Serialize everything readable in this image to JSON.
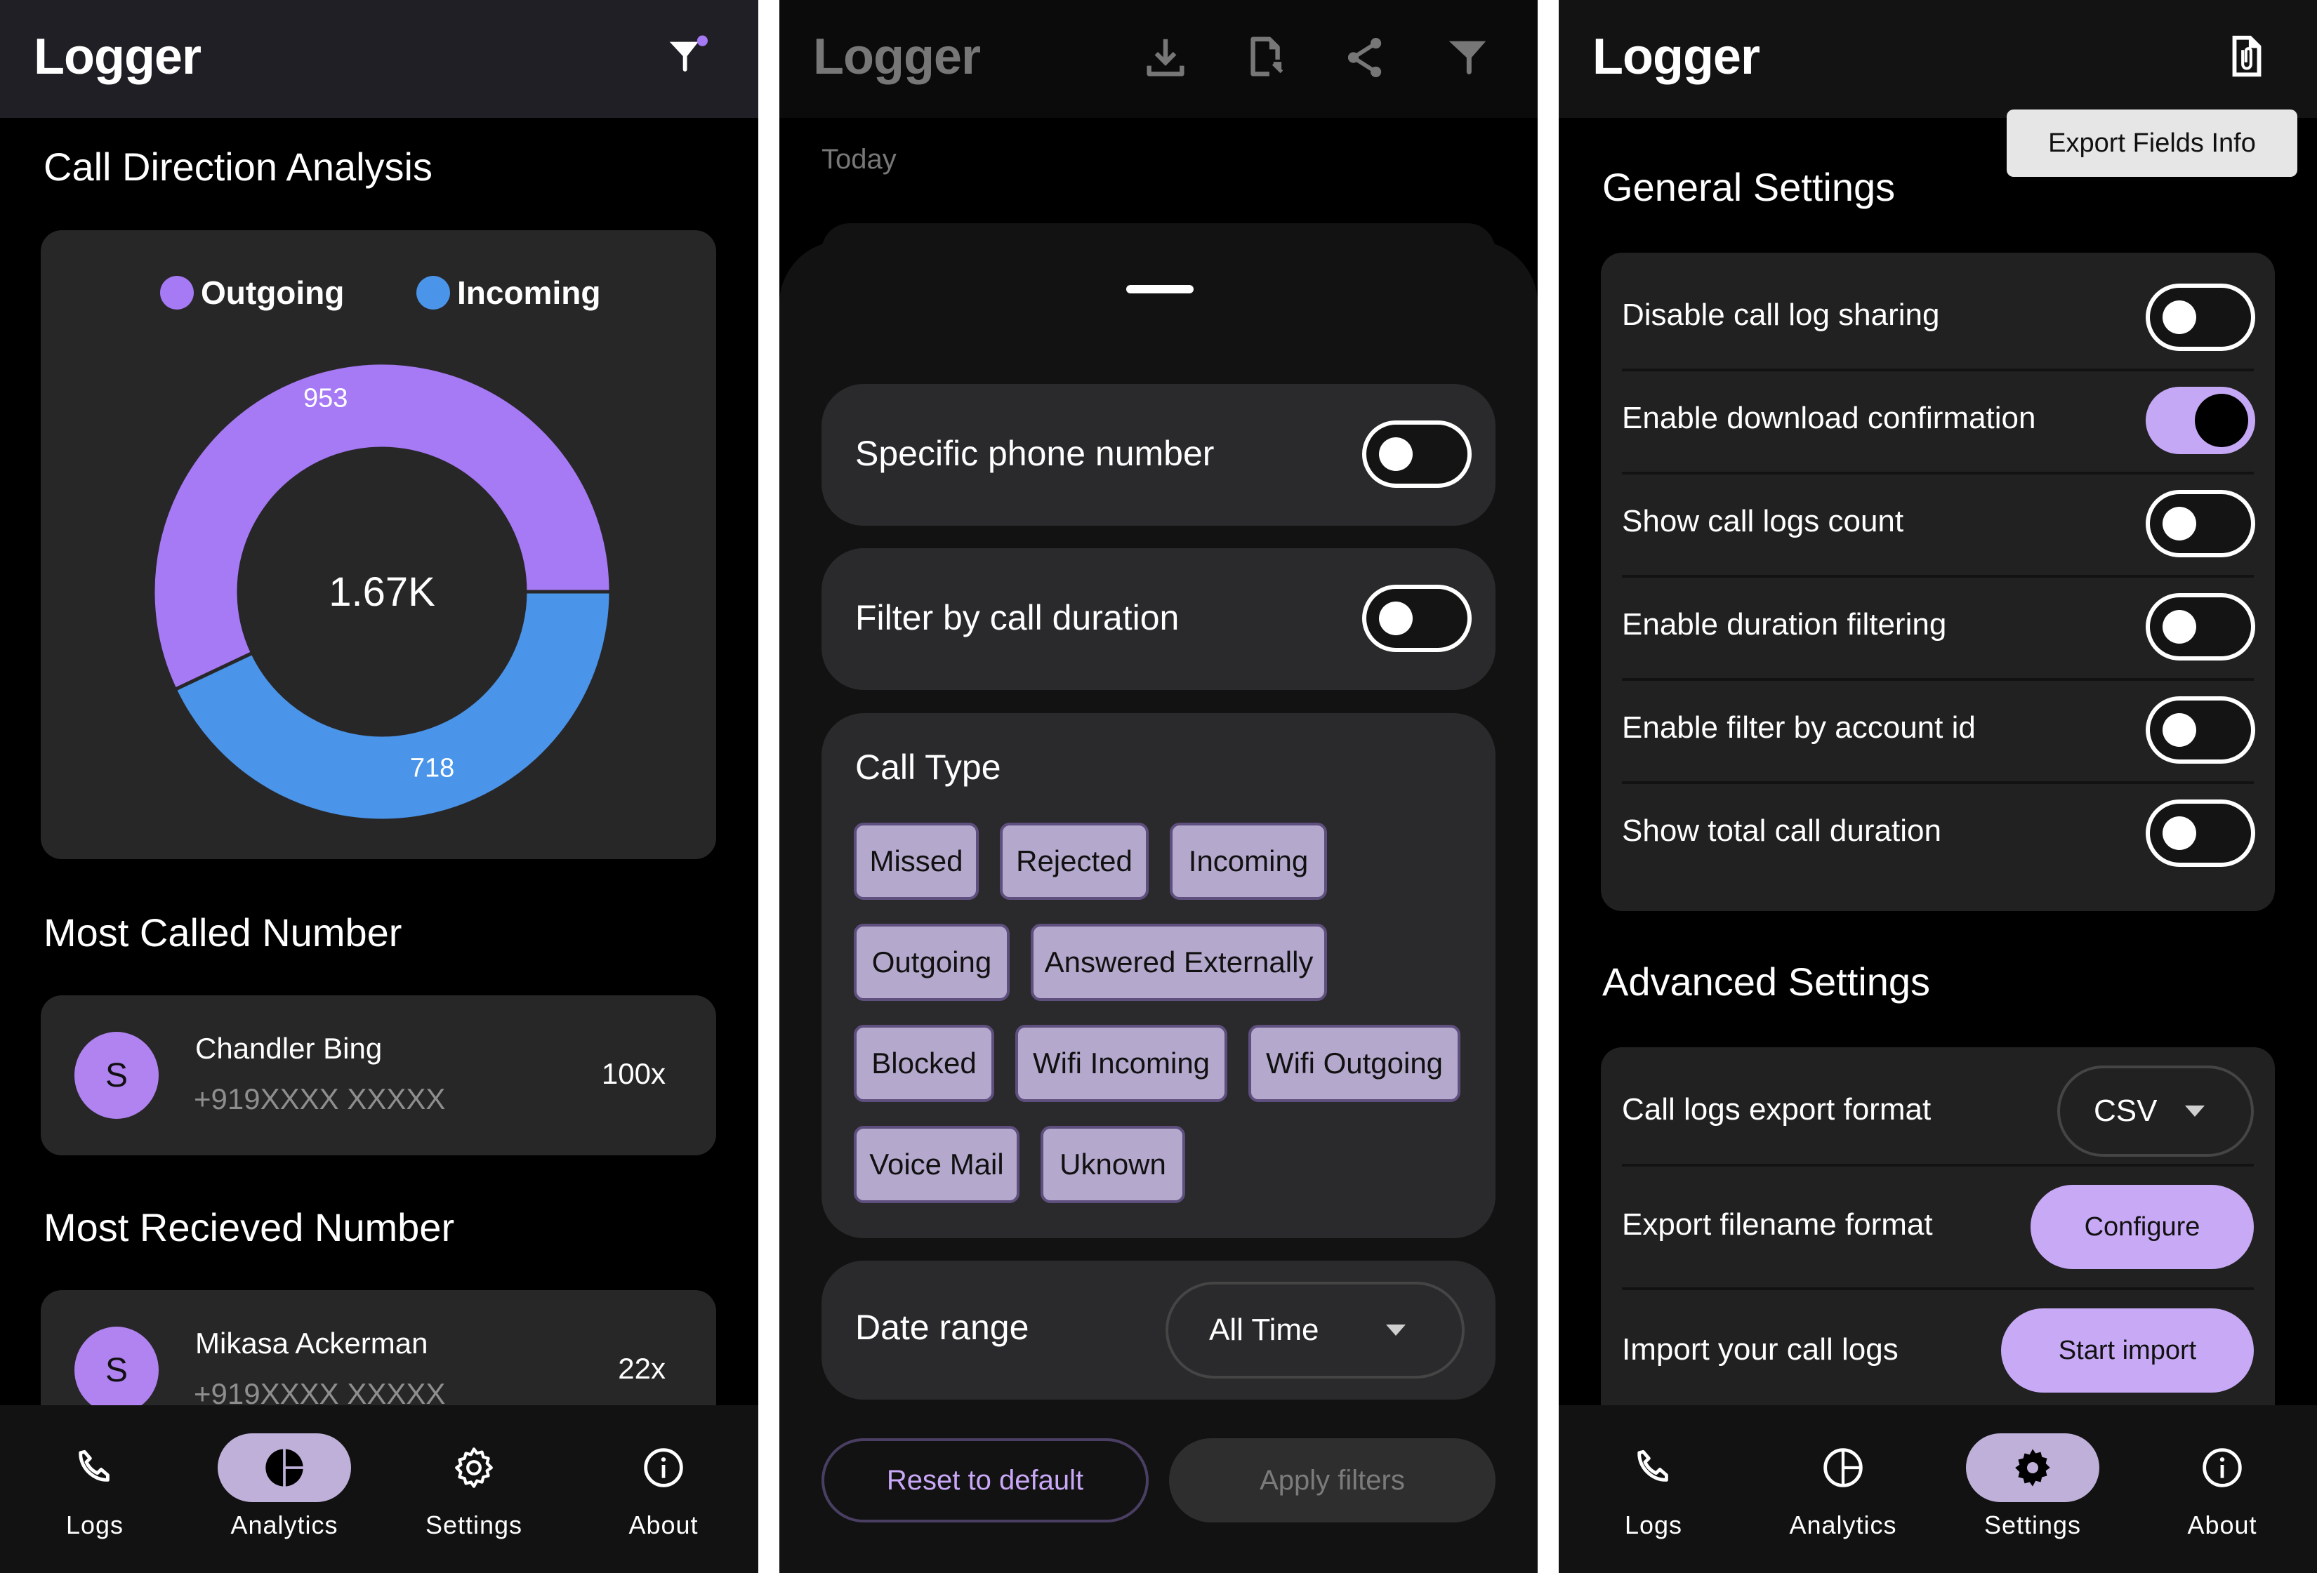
{
  "app": {
    "title": "Logger"
  },
  "colors": {
    "outgoing": "#A679F5",
    "incoming": "#4A94EA",
    "accent": "#C7A9F6",
    "nav_active": "#BFB0D9"
  },
  "nav": {
    "items": [
      {
        "label": "Logs",
        "icon": "phone-icon"
      },
      {
        "label": "Analytics",
        "icon": "pie-chart-icon"
      },
      {
        "label": "Settings",
        "icon": "gear-icon"
      },
      {
        "label": "About",
        "icon": "info-icon"
      }
    ]
  },
  "analytics": {
    "header_icon": "filter-icon",
    "section_title": "Call Direction Analysis",
    "total_label": "1.67K",
    "most_called_title": "Most Called Number",
    "most_called": {
      "avatar_letter": "S",
      "name": "Chandler Bing",
      "number": "+919XXXX XXXXX",
      "count": "100x"
    },
    "most_received_title": "Most Recieved Number",
    "most_received": {
      "avatar_letter": "S",
      "name": "Mikasa Ackerman",
      "number": "+919XXXX XXXXX",
      "count": "22x"
    },
    "active_nav": "Analytics"
  },
  "chart_data": {
    "type": "pie",
    "variant": "donut",
    "title": "Call Direction Analysis",
    "center_label": "1.67K",
    "categories": [
      "Outgoing",
      "Incoming"
    ],
    "values": [
      953,
      718
    ],
    "colors": [
      "#A679F5",
      "#4A94EA"
    ],
    "legend": [
      "Outgoing",
      "Incoming"
    ],
    "legend_position": "top",
    "data_labels": [
      "953",
      "718"
    ]
  },
  "filters": {
    "header_icons": [
      "download-icon",
      "file-export-icon",
      "share-icon",
      "filter-icon"
    ],
    "date_header": "Today",
    "specific_phone_label": "Specific phone number",
    "specific_phone_on": false,
    "duration_label": "Filter by call duration",
    "duration_on": false,
    "call_type_title": "Call Type",
    "call_types": [
      "Missed",
      "Rejected",
      "Incoming",
      "Outgoing",
      "Answered Externally",
      "Blocked",
      "Wifi Incoming",
      "Wifi Outgoing",
      "Voice Mail",
      "Uknown"
    ],
    "date_range_label": "Date range",
    "date_range_value": "All Time",
    "reset_label": "Reset to default",
    "apply_label": "Apply filters"
  },
  "settings": {
    "header_icon": "file-attachment-icon",
    "tooltip": "Export Fields Info",
    "general_title": "General Settings",
    "general": [
      {
        "label": "Disable call log sharing",
        "on": false
      },
      {
        "label": "Enable download confirmation",
        "on": true
      },
      {
        "label": "Show call logs count",
        "on": false
      },
      {
        "label": "Enable duration filtering",
        "on": false
      },
      {
        "label": "Enable filter by account id",
        "on": false
      },
      {
        "label": "Show total call duration",
        "on": false
      }
    ],
    "advanced_title": "Advanced Settings",
    "export_format_label": "Call logs export format",
    "export_format_value": "CSV",
    "filename_label": "Export filename format",
    "filename_button": "Configure",
    "import_label": "Import your call logs",
    "import_button": "Start import",
    "active_nav": "Settings"
  }
}
